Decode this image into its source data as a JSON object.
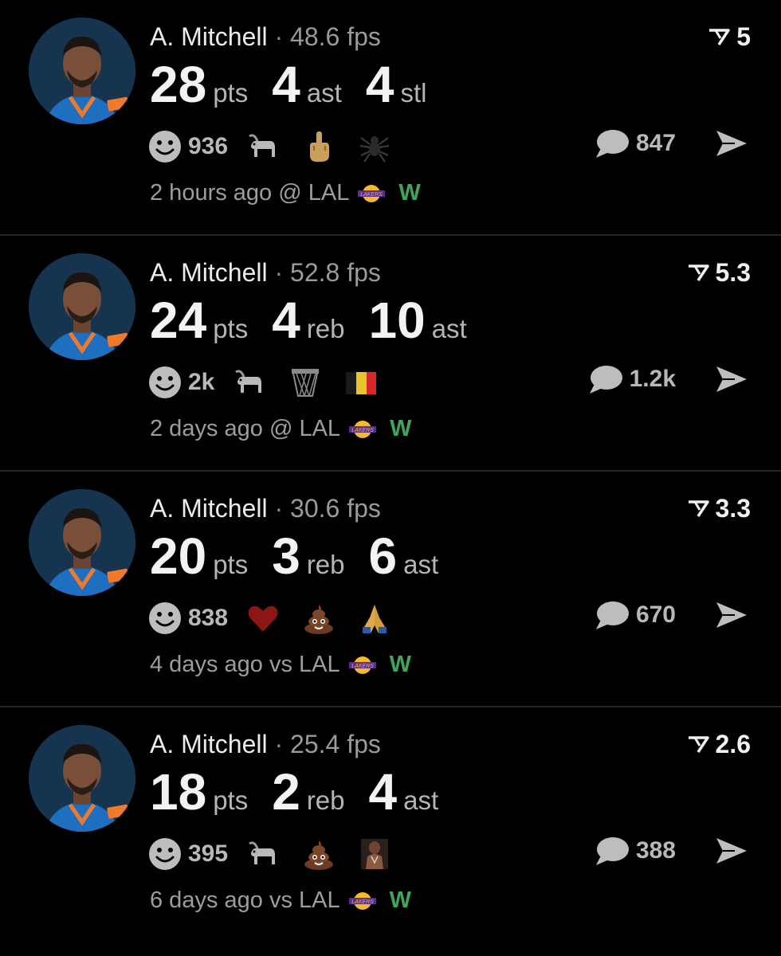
{
  "colors": {
    "background": "#000000",
    "win": "#3fa55a",
    "muted": "#9d9d9d"
  },
  "cards": [
    {
      "name": "A. Mitchell",
      "separator": "·",
      "fps": "48.6 fps",
      "score": "5",
      "stats": [
        {
          "value": "28",
          "unit": "pts"
        },
        {
          "value": "4",
          "unit": "ast"
        },
        {
          "value": "4",
          "unit": "stl"
        }
      ],
      "reaction_count": "936",
      "reactions": [
        "goat-icon",
        "middle-finger-icon",
        "spider-icon"
      ],
      "comment_count": "847",
      "time": "2 hours ago",
      "venue": "@ LAL",
      "result": "W"
    },
    {
      "name": "A. Mitchell",
      "separator": "·",
      "fps": "52.8 fps",
      "score": "5.3",
      "stats": [
        {
          "value": "24",
          "unit": "pts"
        },
        {
          "value": "4",
          "unit": "reb"
        },
        {
          "value": "10",
          "unit": "ast"
        }
      ],
      "reaction_count": "2k",
      "reactions": [
        "goat-icon",
        "basketball-net-icon",
        "belgium-flag-icon"
      ],
      "comment_count": "1.2k",
      "time": "2 days ago",
      "venue": "@ LAL",
      "result": "W"
    },
    {
      "name": "A. Mitchell",
      "separator": "·",
      "fps": "30.6 fps",
      "score": "3.3",
      "stats": [
        {
          "value": "20",
          "unit": "pts"
        },
        {
          "value": "3",
          "unit": "reb"
        },
        {
          "value": "6",
          "unit": "ast"
        }
      ],
      "reaction_count": "838",
      "reactions": [
        "heart-icon",
        "poop-icon",
        "praying-hands-icon"
      ],
      "comment_count": "670",
      "time": "4 days ago",
      "venue": "vs LAL",
      "result": "W"
    },
    {
      "name": "A. Mitchell",
      "separator": "·",
      "fps": "25.4 fps",
      "score": "2.6",
      "stats": [
        {
          "value": "18",
          "unit": "pts"
        },
        {
          "value": "2",
          "unit": "reb"
        },
        {
          "value": "4",
          "unit": "ast"
        }
      ],
      "reaction_count": "395",
      "reactions": [
        "goat-icon",
        "poop-icon",
        "player-sticker-icon"
      ],
      "comment_count": "388",
      "time": "6 days ago",
      "venue": "vs LAL",
      "result": "W"
    }
  ]
}
